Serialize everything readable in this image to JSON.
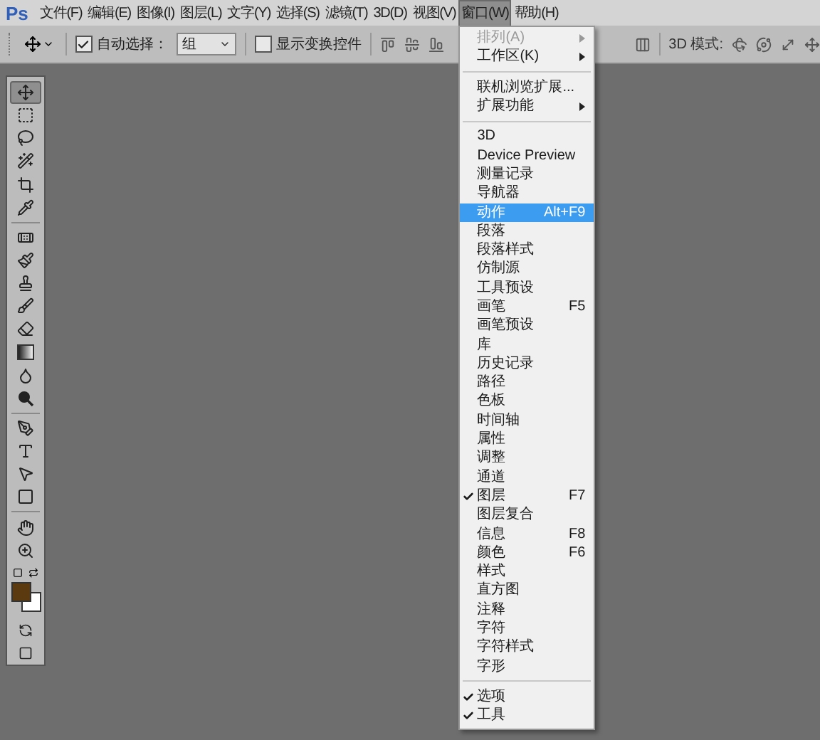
{
  "app_logo": "Ps",
  "menu_bar": [
    {
      "label": "文件(F)",
      "selected": false
    },
    {
      "label": "编辑(E)",
      "selected": false
    },
    {
      "label": "图像(I)",
      "selected": false
    },
    {
      "label": "图层(L)",
      "selected": false
    },
    {
      "label": "文字(Y)",
      "selected": false
    },
    {
      "label": "选择(S)",
      "selected": false
    },
    {
      "label": "滤镜(T)",
      "selected": false
    },
    {
      "label": "3D(D)",
      "selected": false
    },
    {
      "label": "视图(V)",
      "selected": false
    },
    {
      "label": "窗口(W)",
      "selected": true
    },
    {
      "label": "帮助(H)",
      "selected": false
    }
  ],
  "window_menu": [
    {
      "kind": "item",
      "label": "排列(A)",
      "submenu": true,
      "disabled": true,
      "checked": false,
      "selected": false
    },
    {
      "kind": "item",
      "label": "工作区(K)",
      "submenu": true,
      "disabled": false,
      "checked": false,
      "selected": false
    },
    {
      "kind": "separator"
    },
    {
      "kind": "item",
      "label": "联机浏览扩展...",
      "submenu": false,
      "disabled": false,
      "checked": false,
      "selected": false
    },
    {
      "kind": "item",
      "label": "扩展功能",
      "submenu": true,
      "disabled": false,
      "checked": false,
      "selected": false
    },
    {
      "kind": "separator"
    },
    {
      "kind": "item",
      "label": "3D",
      "submenu": false,
      "disabled": false,
      "checked": false,
      "selected": false
    },
    {
      "kind": "item",
      "label": "Device Preview",
      "submenu": false,
      "disabled": false,
      "checked": false,
      "selected": false
    },
    {
      "kind": "item",
      "label": "测量记录",
      "submenu": false,
      "disabled": false,
      "checked": false,
      "selected": false
    },
    {
      "kind": "item",
      "label": "导航器",
      "submenu": false,
      "disabled": false,
      "checked": false,
      "selected": false
    },
    {
      "kind": "item",
      "label": "动作",
      "shortcut": "Alt+F9",
      "submenu": false,
      "disabled": false,
      "checked": false,
      "selected": true
    },
    {
      "kind": "item",
      "label": "段落",
      "submenu": false,
      "disabled": false,
      "checked": false,
      "selected": false
    },
    {
      "kind": "item",
      "label": "段落样式",
      "submenu": false,
      "disabled": false,
      "checked": false,
      "selected": false
    },
    {
      "kind": "item",
      "label": "仿制源",
      "submenu": false,
      "disabled": false,
      "checked": false,
      "selected": false
    },
    {
      "kind": "item",
      "label": "工具预设",
      "submenu": false,
      "disabled": false,
      "checked": false,
      "selected": false
    },
    {
      "kind": "item",
      "label": "画笔",
      "shortcut": "F5",
      "submenu": false,
      "disabled": false,
      "checked": false,
      "selected": false
    },
    {
      "kind": "item",
      "label": "画笔预设",
      "submenu": false,
      "disabled": false,
      "checked": false,
      "selected": false
    },
    {
      "kind": "item",
      "label": "库",
      "submenu": false,
      "disabled": false,
      "checked": false,
      "selected": false
    },
    {
      "kind": "item",
      "label": "历史记录",
      "submenu": false,
      "disabled": false,
      "checked": false,
      "selected": false
    },
    {
      "kind": "item",
      "label": "路径",
      "submenu": false,
      "disabled": false,
      "checked": false,
      "selected": false
    },
    {
      "kind": "item",
      "label": "色板",
      "submenu": false,
      "disabled": false,
      "checked": false,
      "selected": false
    },
    {
      "kind": "item",
      "label": "时间轴",
      "submenu": false,
      "disabled": false,
      "checked": false,
      "selected": false
    },
    {
      "kind": "item",
      "label": "属性",
      "submenu": false,
      "disabled": false,
      "checked": false,
      "selected": false
    },
    {
      "kind": "item",
      "label": "调整",
      "submenu": false,
      "disabled": false,
      "checked": false,
      "selected": false
    },
    {
      "kind": "item",
      "label": "通道",
      "submenu": false,
      "disabled": false,
      "checked": false,
      "selected": false
    },
    {
      "kind": "item",
      "label": "图层",
      "shortcut": "F7",
      "submenu": false,
      "disabled": false,
      "checked": true,
      "selected": false
    },
    {
      "kind": "item",
      "label": "图层复合",
      "submenu": false,
      "disabled": false,
      "checked": false,
      "selected": false
    },
    {
      "kind": "item",
      "label": "信息",
      "shortcut": "F8",
      "submenu": false,
      "disabled": false,
      "checked": false,
      "selected": false
    },
    {
      "kind": "item",
      "label": "颜色",
      "shortcut": "F6",
      "submenu": false,
      "disabled": false,
      "checked": false,
      "selected": false
    },
    {
      "kind": "item",
      "label": "样式",
      "submenu": false,
      "disabled": false,
      "checked": false,
      "selected": false
    },
    {
      "kind": "item",
      "label": "直方图",
      "submenu": false,
      "disabled": false,
      "checked": false,
      "selected": false
    },
    {
      "kind": "item",
      "label": "注释",
      "submenu": false,
      "disabled": false,
      "checked": false,
      "selected": false
    },
    {
      "kind": "item",
      "label": "字符",
      "submenu": false,
      "disabled": false,
      "checked": false,
      "selected": false
    },
    {
      "kind": "item",
      "label": "字符样式",
      "submenu": false,
      "disabled": false,
      "checked": false,
      "selected": false
    },
    {
      "kind": "item",
      "label": "字形",
      "submenu": false,
      "disabled": false,
      "checked": false,
      "selected": false
    },
    {
      "kind": "separator"
    },
    {
      "kind": "item",
      "label": "选项",
      "submenu": false,
      "disabled": false,
      "checked": true,
      "selected": false
    },
    {
      "kind": "item",
      "label": "工具",
      "submenu": false,
      "disabled": false,
      "checked": true,
      "selected": false
    }
  ],
  "options_bar": {
    "auto_select": {
      "label": "自动选择：",
      "checked": true
    },
    "auto_select_target": {
      "value": "组"
    },
    "show_transform_controls": {
      "label": "显示变换控件",
      "checked": false
    },
    "mode_3d_label": "3D 模式:"
  },
  "tool_groups": [
    [
      {
        "kind": "move",
        "selected": true
      },
      {
        "kind": "marquee",
        "selected": false
      },
      {
        "kind": "lasso",
        "selected": false
      },
      {
        "kind": "quick_select",
        "selected": false
      },
      {
        "kind": "crop",
        "selected": false
      },
      {
        "kind": "eyedropper",
        "selected": false
      }
    ],
    [
      {
        "kind": "healing",
        "selected": false
      },
      {
        "kind": "brush",
        "selected": false
      },
      {
        "kind": "stamp",
        "selected": false
      },
      {
        "kind": "history_brush",
        "selected": false
      },
      {
        "kind": "eraser",
        "selected": false
      },
      {
        "kind": "gradient",
        "selected": false
      },
      {
        "kind": "blur",
        "selected": false
      },
      {
        "kind": "dodge",
        "selected": false
      }
    ],
    [
      {
        "kind": "pen",
        "selected": false
      },
      {
        "kind": "type",
        "selected": false
      },
      {
        "kind": "path_select",
        "selected": false
      },
      {
        "kind": "shape",
        "selected": false
      }
    ],
    [
      {
        "kind": "hand",
        "selected": false
      },
      {
        "kind": "zoom",
        "selected": false
      }
    ]
  ],
  "color_swatches": [
    {
      "kind": "foreground",
      "color": "#5a3a0e"
    },
    {
      "kind": "background",
      "color": "#ffffff"
    }
  ]
}
